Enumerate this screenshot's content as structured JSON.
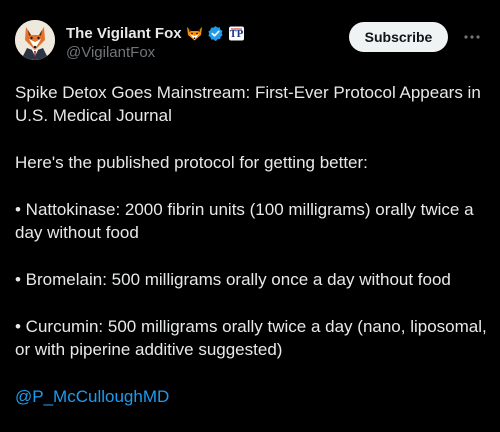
{
  "author": {
    "display_name": "The Vigilant Fox",
    "handle": "@VigilantFox",
    "emoji_icon": "fox-face-icon",
    "verified_icon": "verified-badge-icon",
    "affiliate_icon": "affiliate-badge-icon",
    "verified_color": "#1d9bf0"
  },
  "actions": {
    "subscribe_label": "Subscribe",
    "more_icon": "more-horizontal-icon"
  },
  "tweet": {
    "paragraphs": [
      "Spike Detox Goes Mainstream: First-Ever Protocol Appears in U.S. Medical Journal",
      "Here's the published protocol for getting better:",
      "• Nattokinase: 2000 fibrin units (100 milligrams) orally twice a day without food",
      "• Bromelain: 500 milligrams orally once a day without food",
      "• Curcumin: 500 milligrams orally twice a day (nano, liposomal, or with piperine additive suggested)"
    ],
    "mention": "@P_McCulloughMD"
  },
  "colors": {
    "background": "#000000",
    "text": "#e7e9ea",
    "secondary_text": "#71767b",
    "link": "#1d9bf0",
    "button_bg": "#eff3f4"
  }
}
